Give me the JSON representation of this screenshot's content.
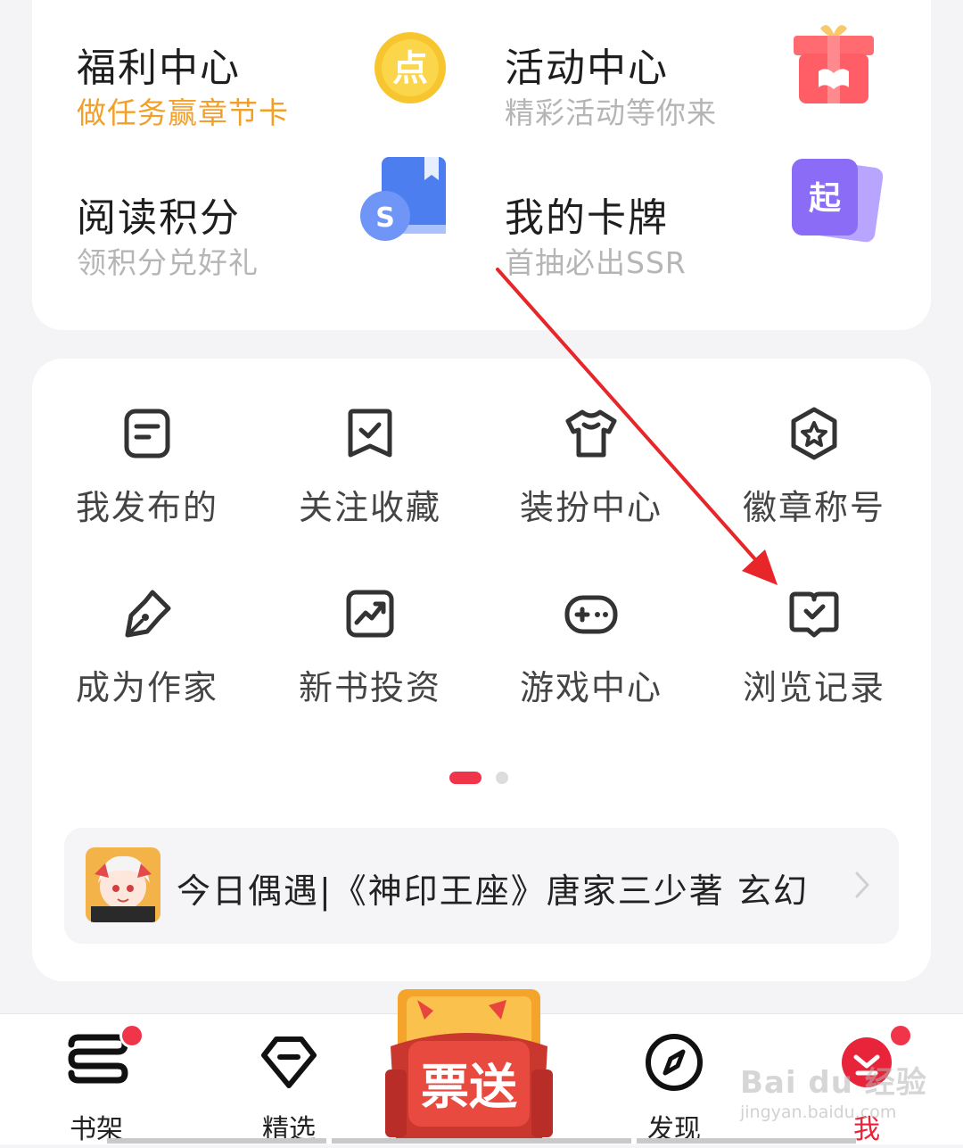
{
  "top_tiles": [
    {
      "title": "福利中心",
      "subtitle": "做任务赢章节卡",
      "icon": "gold-coin-icon"
    },
    {
      "title": "活动中心",
      "subtitle": "精彩活动等你来",
      "icon": "gift-box-icon"
    },
    {
      "title": "阅读积分",
      "subtitle": "领积分兑好礼",
      "icon": "points-book-icon"
    },
    {
      "title": "我的卡牌",
      "subtitle": "首抽必出SSR",
      "icon": "card-deck-icon"
    }
  ],
  "grid_items": [
    {
      "label": "我发布的",
      "icon": "document-icon"
    },
    {
      "label": "关注收藏",
      "icon": "bookmark-check-icon"
    },
    {
      "label": "装扮中心",
      "icon": "tshirt-icon"
    },
    {
      "label": "徽章称号",
      "icon": "badge-star-icon"
    },
    {
      "label": "成为作家",
      "icon": "pen-nib-icon"
    },
    {
      "label": "新书投资",
      "icon": "trend-chart-icon"
    },
    {
      "label": "游戏中心",
      "icon": "gamepad-icon"
    },
    {
      "label": "浏览记录",
      "icon": "history-book-icon"
    }
  ],
  "pagination": {
    "current": 1,
    "total": 2
  },
  "banner": {
    "text": "今日偶遇|《神印王座》唐家三少著 玄幻"
  },
  "popup_badge": {
    "text": "票送"
  },
  "bottom_nav": [
    {
      "label": "书架",
      "icon": "bookshelf-icon",
      "has_dot": true
    },
    {
      "label": "精选",
      "icon": "diamond-icon",
      "has_dot": false
    },
    {
      "label": "发现",
      "icon": "compass-icon",
      "has_dot": false
    },
    {
      "label": "我",
      "icon": "profile-icon",
      "has_dot": true,
      "active": true
    }
  ],
  "watermark": {
    "text": "Bai du 经验",
    "sub": "jingyan.baidu.com"
  },
  "colors": {
    "accent": "#f0344a",
    "subtitle_orange": "#f2a02a",
    "annotation_arrow": "#e8262a"
  }
}
